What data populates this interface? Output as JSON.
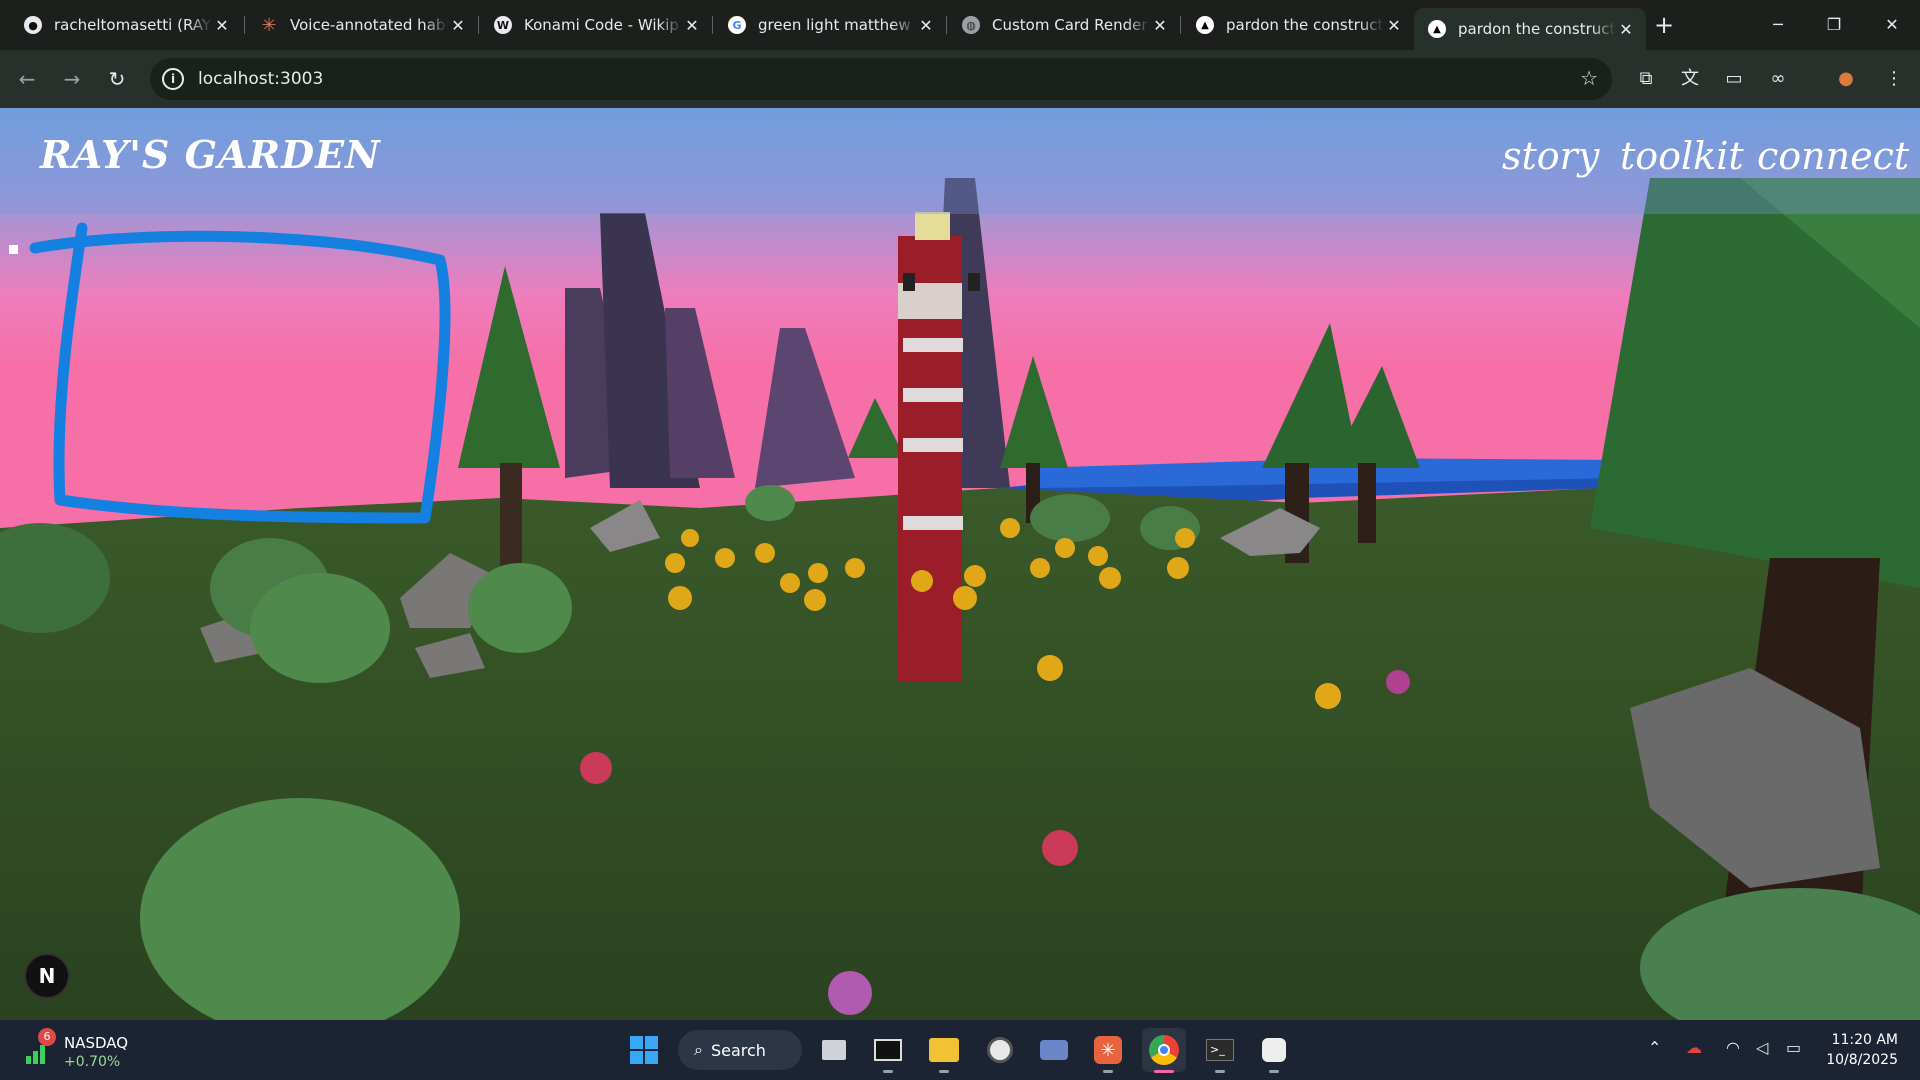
{
  "browser": {
    "tabs": [
      {
        "title": "racheltomasetti (RAY)",
        "icon": "github-icon"
      },
      {
        "title": "Voice-annotated habi",
        "icon": "claude-icon"
      },
      {
        "title": "Konami Code - Wikip",
        "icon": "wikipedia-icon"
      },
      {
        "title": "green light matthew",
        "icon": "google-icon"
      },
      {
        "title": "Custom Card Renderi",
        "icon": "globe-icon"
      },
      {
        "title": "pardon the constructi",
        "icon": "triangle-icon"
      },
      {
        "title": "pardon the constructi",
        "icon": "triangle-icon",
        "active": true
      }
    ],
    "url": "localhost:3003"
  },
  "site": {
    "logo": "RAY'S GARDEN",
    "nav": [
      "story",
      "toolkit",
      "connect"
    ],
    "badge": "N"
  },
  "colors": {
    "sky_top": "#6fa4de",
    "sky_bottom": "#f47bb2",
    "grass": "#304a25",
    "drawn_box": "#1480e0",
    "lighthouse_red": "#9b1d2a"
  },
  "taskbar": {
    "widget": {
      "badge": "6",
      "name": "NASDAQ",
      "change": "+0.70%"
    },
    "search_label": "Search",
    "time": "11:20 AM",
    "date": "10/8/2025"
  }
}
